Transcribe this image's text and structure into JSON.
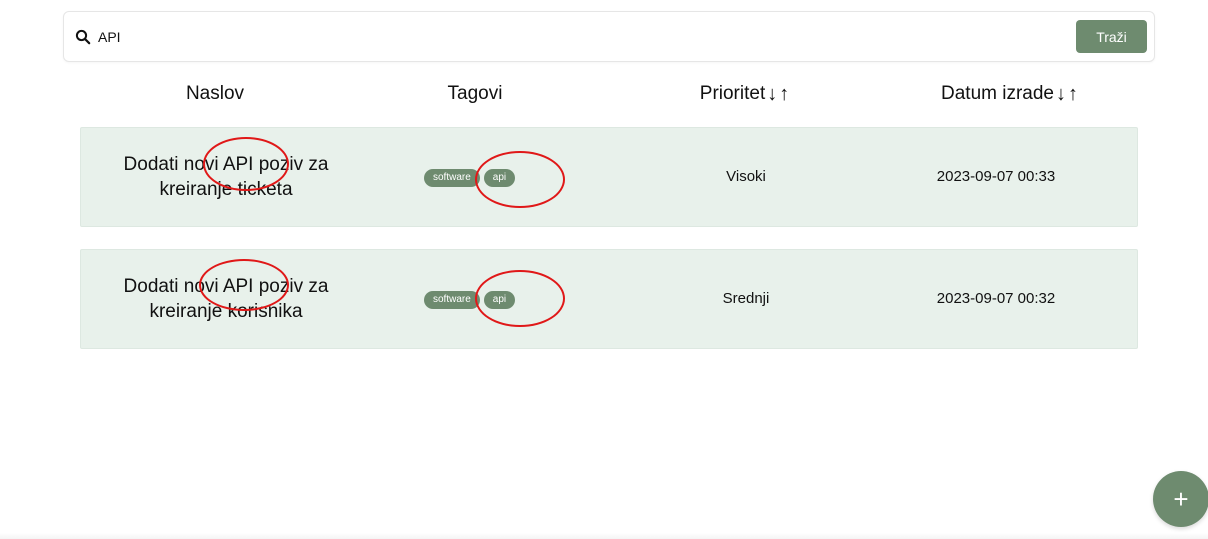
{
  "search": {
    "value": "API",
    "button_label": "Traži"
  },
  "colors": {
    "accent": "#6e8b6f",
    "row_background": "#e8f1eb",
    "annotation": "#e01818"
  },
  "table": {
    "headers": {
      "title": "Naslov",
      "tags": "Tagovi",
      "priority": "Prioritet",
      "date": "Datum izrade"
    },
    "sort_icons": {
      "down": "↓",
      "up": "↑"
    },
    "rows": [
      {
        "title": "Dodati novi API poziv za kreiranje ticketa",
        "tags": [
          "software",
          "api"
        ],
        "priority": "Visoki",
        "date": "2023-09-07 00:33"
      },
      {
        "title": "Dodati novi API poziv za kreiranje korisnika",
        "tags": [
          "software",
          "api"
        ],
        "priority": "Srednji",
        "date": "2023-09-07 00:32"
      }
    ]
  },
  "fab": {
    "icon": "plus-icon",
    "label": "+"
  }
}
